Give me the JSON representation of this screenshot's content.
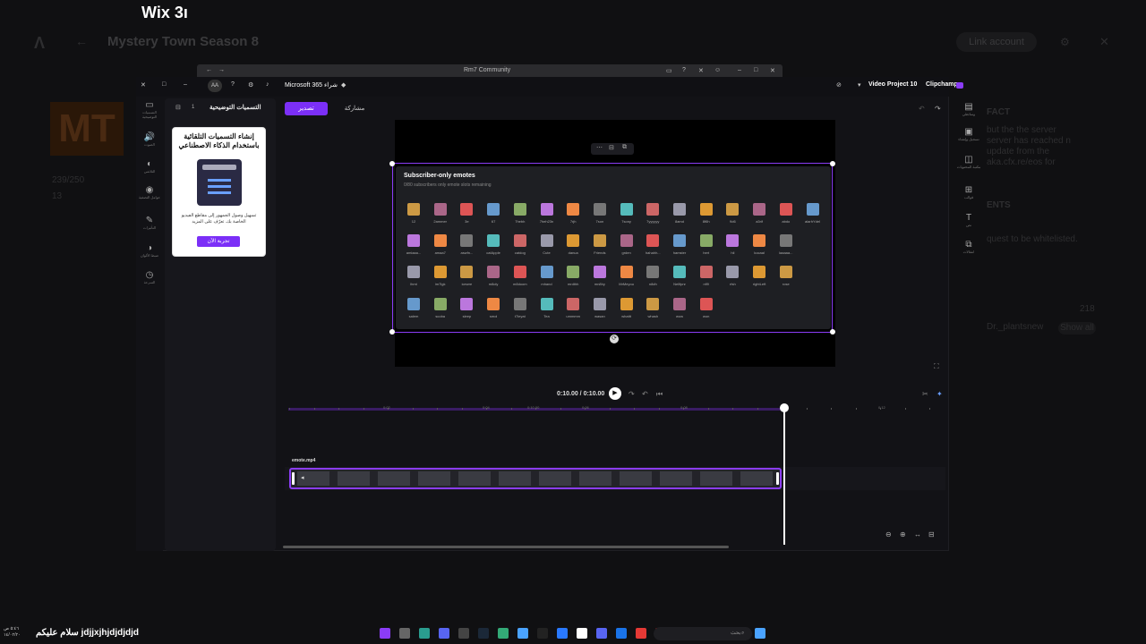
{
  "wix_title": "Wix 3ı",
  "background": {
    "title": "Mystery Town Season 8",
    "link_account": "Link account",
    "logo_text": "MT",
    "player_count": "239/250",
    "sub_count": "13",
    "side_heading_fact": "FACT",
    "side_text_server": "but the the server server has reached n update from the aka.cfx.re/eos for",
    "side_heading_ents": "ENTS",
    "side_text_quest": "quest to be whitelisted.",
    "side_number": "218",
    "side_dr": "Dr._plantsnew",
    "show_all": "Show all"
  },
  "browser": {
    "tab_title": "Rm7 Community"
  },
  "topbar": {
    "avatar": "AA",
    "ms365": "Microsoft 365 شراء",
    "project_name": "Video Project 10",
    "brand": "Clipchamp"
  },
  "left_rail": [
    {
      "icon": "▭",
      "label": "التسميات التوضيحية"
    },
    {
      "icon": "🔊",
      "label": "الصوت"
    },
    {
      "icon": "◐",
      "label": "التلاشي"
    },
    {
      "icon": "◉",
      "label": "عوامل التصفية"
    },
    {
      "icon": "✎",
      "label": "التأثيرات"
    },
    {
      "icon": "◑",
      "label": "ضبط الألوان"
    },
    {
      "icon": "◷",
      "label": "السرعة"
    }
  ],
  "panel": {
    "title": "التسميات التوضيحية",
    "count": "1",
    "ai_title": "إنشاء التسميات التلقائية باستخدام الذكاء الاصطناعي",
    "ai_desc": "تسهيل وصول الجمهور إلى مقاطع الفيديو الخاصة بك. تعرّف على المزيد",
    "ai_button": "تجربة الآن"
  },
  "toolbar": {
    "export": "تصدير",
    "share": "مشاركة"
  },
  "emote_panel": {
    "title": "Subscriber-only emotes",
    "subtitle": "0/80 subscribers only emote slots remaining",
    "rows": [
      [
        "12",
        "2ammer",
        "3e",
        "67",
        "7hebh",
        "7heh23n",
        "7rjh",
        "7son",
        "7sony",
        "7yyyyyy",
        "8amd",
        "8f6h",
        "9d6",
        "a3rif",
        "abdo",
        "alarhYdel"
      ],
      [
        "amiaaa...",
        "amaa7",
        "aswfn...",
        "catApple",
        "catdog",
        "Cute",
        "danua",
        "Friends",
        "grden",
        "hahahh...",
        "hamster",
        "hert",
        "hli",
        "kocaal",
        "laaaaa..."
      ],
      [
        "lhmt",
        "im7lgk",
        "icewre",
        "m8oly",
        "m8doom",
        "mhand",
        "mrdthh",
        "mn8hy",
        "MrMeyou",
        "n8dh",
        "Nellfpnr",
        "nfl9",
        "rfsh",
        "rightLeft",
        "rose"
      ],
      [
        "salem",
        "scoba",
        "sleep",
        "smol",
        "t7leyat",
        "Tea",
        "ummmm",
        "wasan",
        "whattt",
        "whash",
        "wow",
        "won"
      ]
    ]
  },
  "timeline": {
    "time": "0:10.00 / 0:10.00",
    "ruler_labels": [
      "0:02",
      "0:04",
      "0:10.00",
      "0:06",
      "0:08",
      "0:12"
    ],
    "clip_name": "emote.mp4"
  },
  "right_rail": [
    {
      "icon": "▤",
      "label": "وسائطي"
    },
    {
      "icon": "▣",
      "label": "تسجيل وإنشاء"
    },
    {
      "icon": "◫",
      "label": "مكتبة المحتويات"
    },
    {
      "icon": "⊞",
      "label": "قوالب"
    },
    {
      "icon": "T",
      "label": "نص"
    },
    {
      "icon": "⧉",
      "label": "انتقالات"
    }
  ],
  "taskbar": {
    "left_text": "سلام عليكم jdjjxjhjdjdjdjd",
    "clock": "٥:٤٦ ص ١٤/٠٢/٢٠",
    "search_placeholder": "بحث"
  },
  "colors": {
    "accent": "#7b2ff7",
    "selection": "#8b3cf7"
  }
}
